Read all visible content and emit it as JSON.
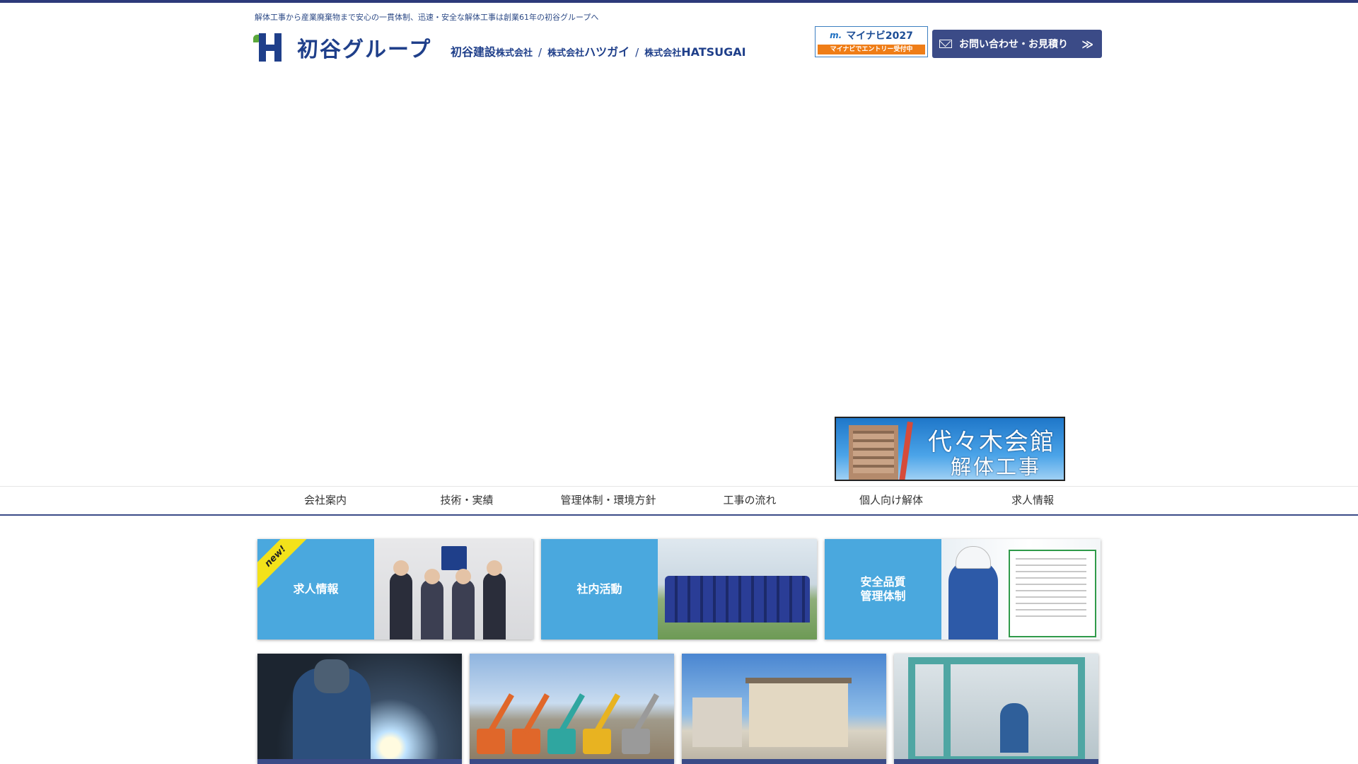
{
  "header": {
    "tagline": "解体工事から産業廃棄物まで安心の一貫体制、迅速・安全な解体工事は創業61年の初谷グループへ",
    "logo_text": "初谷グループ",
    "companies": [
      {
        "name": "初谷建設",
        "suffix": "株式会社"
      },
      {
        "prefix": "株式会社",
        "name": "ハツガイ"
      },
      {
        "prefix": "株式会社",
        "name": "HATSUGAI"
      }
    ],
    "separator": "/",
    "mynavi": {
      "title": "マイナビ2027",
      "sub": "マイナビでエントリー受付中",
      "mark": "m."
    },
    "contact_label": "お問い合わせ・お見積り",
    "contact_chevron": "≫",
    "brand_color": "#1f3f8a",
    "accent_color": "#3b4b87"
  },
  "banner": {
    "line1": "代々木会館",
    "line2": "解体工事"
  },
  "nav": {
    "items": [
      "会社案内",
      "技術・実績",
      "管理体制・環境方針",
      "工事の流れ",
      "個人向け解体",
      "求人情報"
    ]
  },
  "cards": [
    {
      "label": "求人情報",
      "badge": "new!"
    },
    {
      "label": "社内活動"
    },
    {
      "label": "安全品質\n管理体制"
    }
  ],
  "photos": [
    {
      "icon": "welding-photo"
    },
    {
      "icon": "excavators-photo"
    },
    {
      "icon": "house-photo"
    },
    {
      "icon": "machine-cab-photo"
    }
  ]
}
